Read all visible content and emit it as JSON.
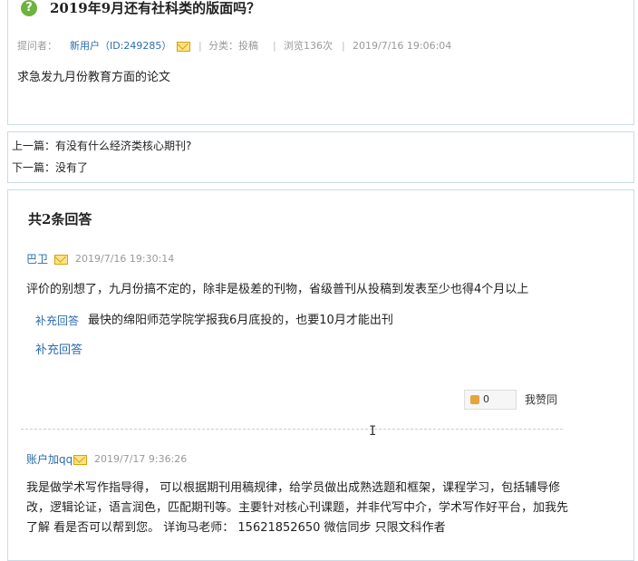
{
  "question": {
    "title": "2019年9月还有社科类的版面吗？",
    "asker_label": "提问者：",
    "asker_name": "新用户（ID:249285）",
    "category": "分类：投稿",
    "views": "浏览136次",
    "time": "2019/7/16 19:06:04",
    "body": "求急发九月份教育方面的论文"
  },
  "nav": {
    "prev": "上一篇：有没有什么经济类核心期刊?",
    "next": "下一篇：没有了"
  },
  "answers": {
    "header": "共2条回答",
    "items": [
      {
        "user": "巴卫",
        "time": "2019/7/16 19:30:14",
        "text": "评价的别想了，九月份搞不定的，除非是极差的刊物，省级普刊从投稿到发表至少也得4个月以上",
        "supplement_label": "补充回答",
        "supplement_text": "最快的绵阳师范学院学报我6月底投的，也要10月才能出刊",
        "supplement_link": "补充回答",
        "like_count": "0",
        "agree_label": "我赞同"
      },
      {
        "user": "账户加qq",
        "time": "2019/7/17 9:36:26",
        "text": "我是做学术写作指导得，  可以根据期刊用稿规律，给学员做出成熟选题和框架，课程学习，包括辅导修改，逻辑论证，语言润色，匹配期刊等。主要针对核心刊课题，并非代写中介，学术写作好平台，加我先了解  看是否可以帮到您。  详询马老师：  15621852650 微信同步  只限文科作者"
      }
    ]
  },
  "colors": {
    "link": "#2b6dad",
    "border": "#c9dbe8",
    "question_icon": "#6db33f"
  },
  "icons": [
    "question-icon",
    "mail-icon",
    "thumbs-up-icon",
    "text-cursor-icon"
  ]
}
